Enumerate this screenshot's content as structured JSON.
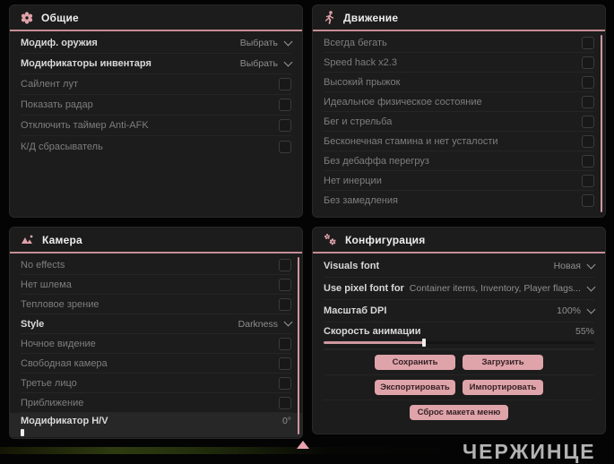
{
  "colors": {
    "accent": "#dfa1a8",
    "underline": "#c68d95",
    "panel_bg": "#1c1c1c",
    "button_bg": "#dfa3aa"
  },
  "panels": {
    "general": {
      "title": "Общие",
      "icon": "flower-gear-icon",
      "rows": [
        {
          "label": "Модиф. оружия",
          "type": "dropdown",
          "value": "Выбрать"
        },
        {
          "label": "Модификаторы инвентаря",
          "type": "dropdown",
          "value": "Выбрать"
        },
        {
          "label": "Сайлент лут",
          "type": "checkbox",
          "checked": false
        },
        {
          "label": "Показать радар",
          "type": "checkbox",
          "checked": false
        },
        {
          "label": "Отключить таймер Anti-AFK",
          "type": "checkbox",
          "checked": false
        },
        {
          "label": "К/Д сбрасыватель",
          "type": "checkbox",
          "checked": false
        }
      ]
    },
    "movement": {
      "title": "Движение",
      "icon": "runner-icon",
      "rows": [
        {
          "label": "Всегда бегать",
          "type": "checkbox",
          "checked": false
        },
        {
          "label": "Speed hack x2.3",
          "type": "checkbox",
          "checked": false
        },
        {
          "label": "Высокий прыжок",
          "type": "checkbox",
          "checked": false
        },
        {
          "label": "Идеальное физическое состояние",
          "type": "checkbox",
          "checked": false
        },
        {
          "label": "Бег и стрельба",
          "type": "checkbox",
          "checked": false
        },
        {
          "label": "Бесконечная стамина и нет усталости",
          "type": "checkbox",
          "checked": false
        },
        {
          "label": "Без дебаффа перегруз",
          "type": "checkbox",
          "checked": false
        },
        {
          "label": "Нет инерции",
          "type": "checkbox",
          "checked": false
        },
        {
          "label": "Без замедления",
          "type": "checkbox",
          "checked": false
        }
      ]
    },
    "camera": {
      "title": "Камера",
      "icon": "image-icon",
      "rows": [
        {
          "label": "No effects",
          "type": "checkbox",
          "checked": false
        },
        {
          "label": "Нет шлема",
          "type": "checkbox",
          "checked": false
        },
        {
          "label": "Тепловое зрение",
          "type": "checkbox",
          "checked": false
        },
        {
          "label": "Style",
          "type": "dropdown",
          "value": "Darkness"
        },
        {
          "label": "Ночное видение",
          "type": "checkbox",
          "checked": false
        },
        {
          "label": "Свободная камера",
          "type": "checkbox",
          "checked": false
        },
        {
          "label": "Третье лицо",
          "type": "checkbox",
          "checked": false
        },
        {
          "label": "Приближение",
          "type": "checkbox",
          "checked": false
        },
        {
          "label": "Модификатор H/V",
          "type": "slider",
          "value": "0°",
          "percent": 0
        }
      ]
    },
    "config": {
      "title": "Конфигурация",
      "icon": "gears-icon",
      "rows": [
        {
          "label": "Visuals font",
          "type": "dropdown",
          "value": "Новая"
        },
        {
          "label": "Use pixel font for",
          "type": "dropdown",
          "value": "Container items, Inventory, Player flags..."
        },
        {
          "label": "Масштаб DPI",
          "type": "dropdown",
          "value": "100%"
        },
        {
          "label": "Скорость анимации",
          "type": "slider",
          "value": "55%",
          "percent": 55
        }
      ],
      "buttons": {
        "save": "Сохранить",
        "load": "Загрузить",
        "export": "Экспортировать",
        "import": "Импортировать",
        "reset": "Сброс макета меню"
      }
    }
  },
  "watermark": "ЧЕРЖИНЦЕ"
}
